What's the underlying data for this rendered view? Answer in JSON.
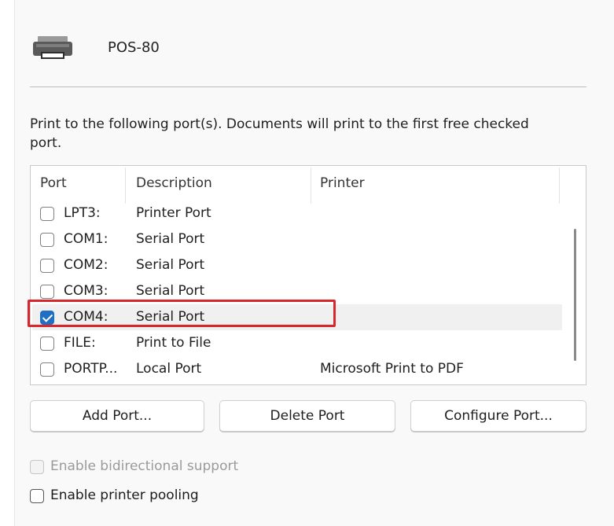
{
  "header": {
    "printer_name": "POS-80",
    "icon": "printer-icon"
  },
  "intro_text": "Print to the following port(s). Documents will print to the first free checked port.",
  "ports_table": {
    "columns": [
      "Port",
      "Description",
      "Printer"
    ],
    "rows": [
      {
        "port": "LPT3:",
        "description": "Printer Port",
        "printer": "",
        "checked": false
      },
      {
        "port": "COM1:",
        "description": "Serial Port",
        "printer": "",
        "checked": false
      },
      {
        "port": "COM2:",
        "description": "Serial Port",
        "printer": "",
        "checked": false
      },
      {
        "port": "COM3:",
        "description": "Serial Port",
        "printer": "",
        "checked": false
      },
      {
        "port": "COM4:",
        "description": "Serial Port",
        "printer": "",
        "checked": true
      },
      {
        "port": "FILE:",
        "description": "Print to File",
        "printer": "",
        "checked": false
      },
      {
        "port": "PORTP...",
        "description": "Local Port",
        "printer": "Microsoft Print to PDF",
        "checked": false
      }
    ],
    "selected_row": 4,
    "annotation_color": "#d9262c",
    "check_color": "#1f6fc4"
  },
  "buttons": {
    "add_port": "Add Port...",
    "delete_port": "Delete Port",
    "configure_port": "Configure Port..."
  },
  "options": {
    "bidirectional": {
      "label": "Enable bidirectional support",
      "checked": false,
      "disabled": true
    },
    "pooling": {
      "label": "Enable printer pooling",
      "checked": false,
      "disabled": false
    }
  }
}
